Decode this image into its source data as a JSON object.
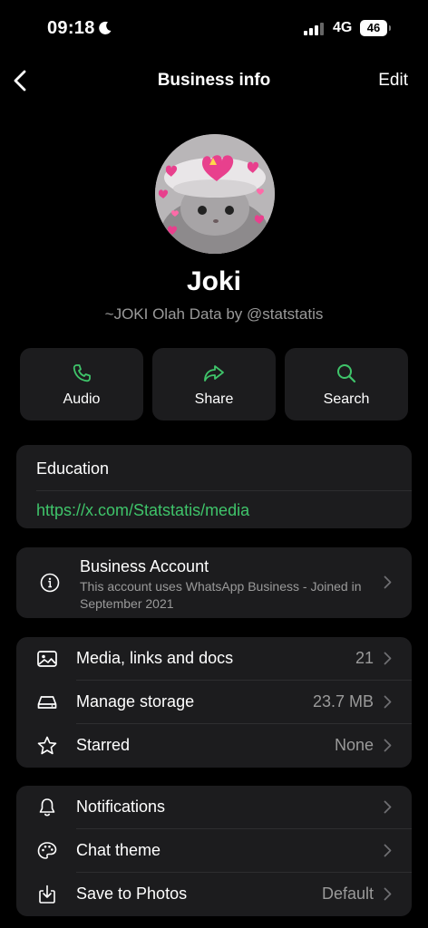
{
  "status_bar": {
    "time": "09:18",
    "network": "4G",
    "battery": "46"
  },
  "nav": {
    "title": "Business info",
    "edit_label": "Edit"
  },
  "profile": {
    "name": "Joki",
    "subtitle": "~JOKI Olah Data by @statstatis"
  },
  "actions": [
    {
      "label": "Audio",
      "icon": "phone-icon"
    },
    {
      "label": "Share",
      "icon": "share-arrow-icon"
    },
    {
      "label": "Search",
      "icon": "search-icon"
    }
  ],
  "education": {
    "label": "Education",
    "link": "https://x.com/Statstatis/media"
  },
  "business_account": {
    "title": "Business Account",
    "description": "This account uses WhatsApp Business - Joined in September 2021"
  },
  "media_group": [
    {
      "label": "Media, links and docs",
      "value": "21",
      "icon": "image-icon"
    },
    {
      "label": "Manage storage",
      "value": "23.7 MB",
      "icon": "storage-icon"
    },
    {
      "label": "Starred",
      "value": "None",
      "icon": "star-icon"
    }
  ],
  "settings_group": [
    {
      "label": "Notifications",
      "value": "",
      "icon": "bell-icon"
    },
    {
      "label": "Chat theme",
      "value": "",
      "icon": "palette-icon"
    },
    {
      "label": "Save to Photos",
      "value": "Default",
      "icon": "save-download-icon"
    }
  ],
  "colors": {
    "background": "#000000",
    "card": "#1c1c1e",
    "accent_green": "#3fc46a",
    "secondary_text": "#9a9a9a"
  }
}
